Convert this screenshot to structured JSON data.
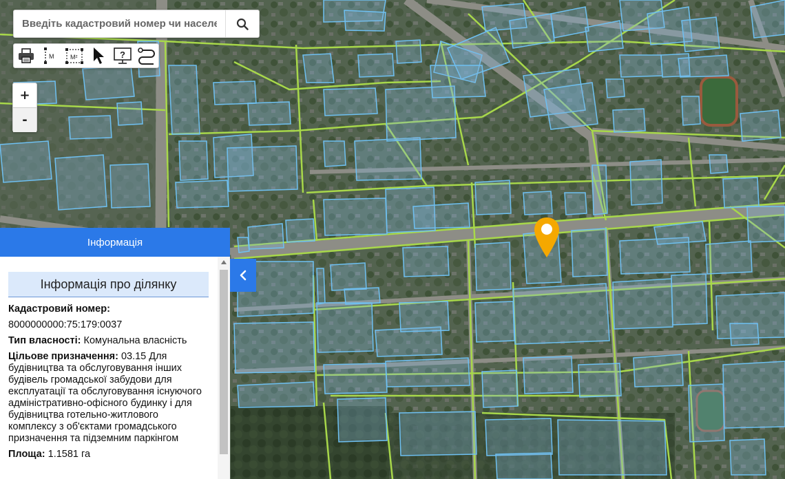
{
  "search": {
    "placeholder": "Введіть кадастровий номер чи населе"
  },
  "toolbar": {
    "tools": [
      "printer-icon",
      "measure-length-icon",
      "measure-area-icon",
      "pointer-icon",
      "help-icon",
      "route-icon"
    ],
    "length_label": "M",
    "area_label": "M²"
  },
  "zoom": {
    "in_label": "+",
    "out_label": "-"
  },
  "panel": {
    "header": "Інформація",
    "subheader": "Інформація про ділянку",
    "cadastral_label": "Кадастровий номер:",
    "cadastral_value": "8000000000:75:179:0037",
    "ownership_label": "Тип власності:",
    "ownership_value": "Комунальна власність",
    "purpose_label": "Цільове призначення:",
    "purpose_value": "03.15 Для будівництва та обслуговування інших будівель громадської забудови для експлуатації та обслуговування існуючого адміністративно-офісного будинку і для будівництва готельно-житлового комплексу з об'єктами громадського призначення та підземним паркінгом",
    "area_label": "Площа:",
    "area_value": "1.1581 га"
  },
  "colors": {
    "accent": "#2b79e8",
    "parcel_outline": "#6ec0f2",
    "quarter_line": "#a8d84a",
    "marker": "#f5a800"
  }
}
